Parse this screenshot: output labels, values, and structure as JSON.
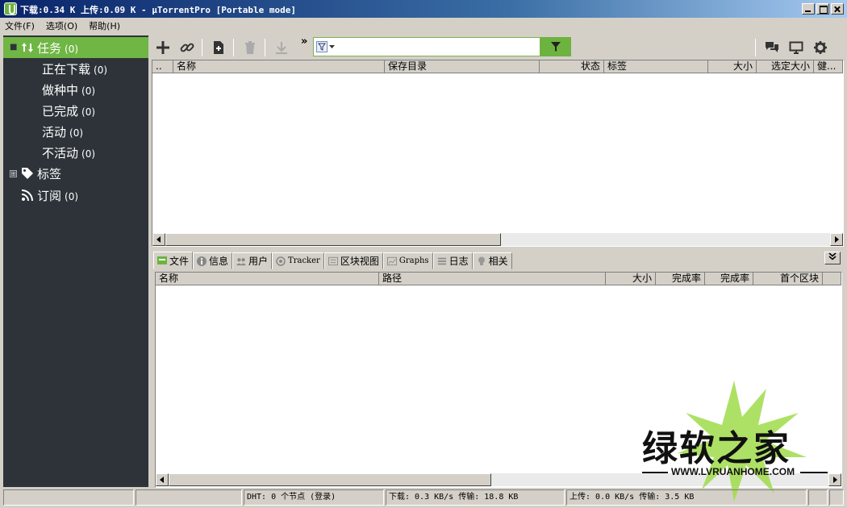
{
  "window": {
    "title": "下载:0.34 K 上传:0.09 K - μTorrentPro [Portable mode]"
  },
  "menu": [
    "文件(F)",
    "选项(O)",
    "帮助(H)"
  ],
  "sidebar": {
    "items": [
      {
        "label": "任务",
        "count": "(0)"
      },
      {
        "label": "正在下载",
        "count": "(0)"
      },
      {
        "label": "做种中",
        "count": "(0)"
      },
      {
        "label": "已完成",
        "count": "(0)"
      },
      {
        "label": "活动",
        "count": "(0)"
      },
      {
        "label": "不活动",
        "count": "(0)"
      },
      {
        "label": "标签",
        "count": ""
      },
      {
        "label": "订阅",
        "count": "(0)"
      }
    ],
    "expanders": [
      "■",
      "⊞"
    ]
  },
  "toolbar": {
    "overflow": "»"
  },
  "torrent_list": {
    "columns": [
      "..",
      "名称",
      "保存目录",
      "状态",
      "标签",
      "大小",
      "选定大小",
      "健..."
    ]
  },
  "tabs": [
    {
      "label": "文件"
    },
    {
      "label": "信息"
    },
    {
      "label": "用户"
    },
    {
      "label": "Tracker"
    },
    {
      "label": "区块视图"
    },
    {
      "label": "Graphs"
    },
    {
      "label": "日志"
    },
    {
      "label": "相关"
    }
  ],
  "files_list": {
    "columns": [
      "名称",
      "路径",
      "大小",
      "完成率",
      "完成率",
      "首个区块"
    ]
  },
  "statusbar": {
    "dht": "DHT: 0 个节点  (登录)",
    "download": "下载: 0.3 KB/s 传输: 18.8 KB",
    "upload": "上传: 0.0 KB/s 传输: 3.5 KB"
  },
  "watermark": {
    "title": "绿软之家",
    "url": "WWW.LVRUANHOME.COM"
  },
  "colors": {
    "accent": "#70b644",
    "sidebar_bg": "#2d3339"
  }
}
